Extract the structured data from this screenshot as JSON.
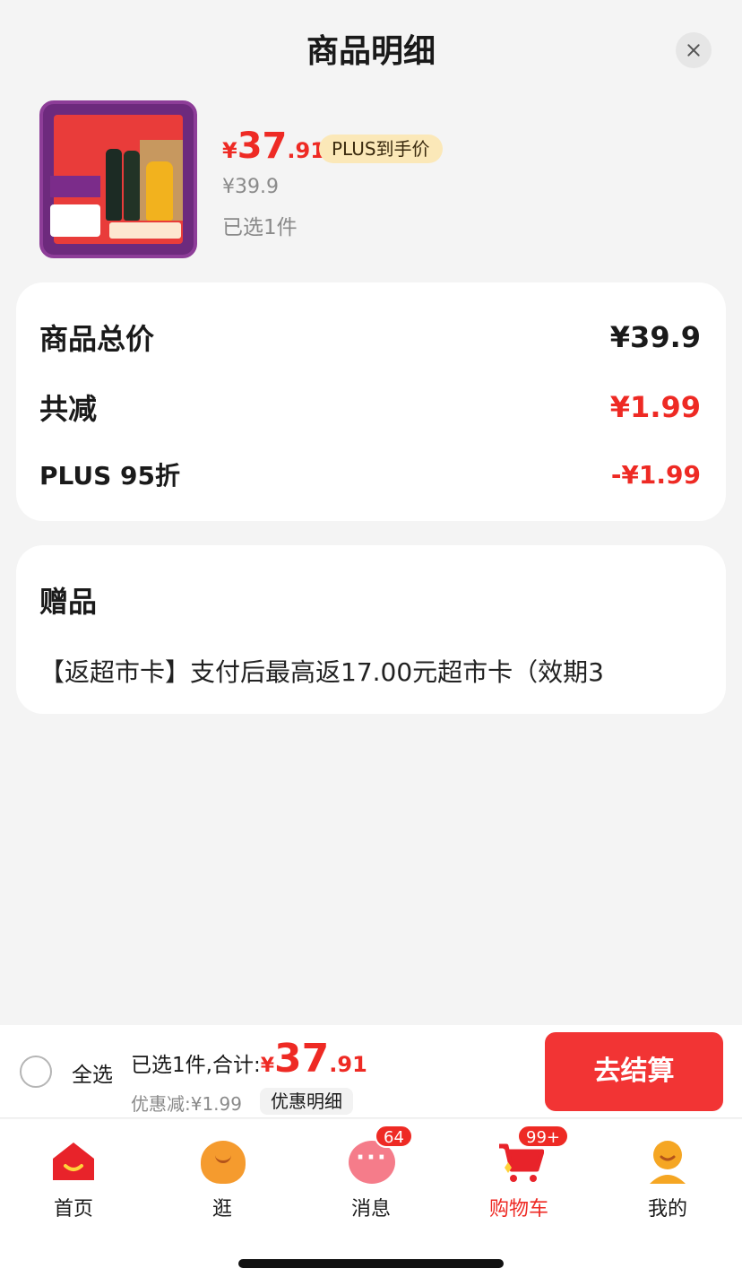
{
  "header": {
    "title": "商品明细"
  },
  "product": {
    "price_yen": "¥",
    "price_int": "37",
    "price_dec": ".91",
    "plus_badge": "PLUS到手价",
    "original_price": "¥39.9",
    "selected": "已选1件"
  },
  "summary": {
    "rows": [
      {
        "label": "商品总价",
        "value": "¥39.9"
      },
      {
        "label": "共减",
        "value": "¥1.99"
      },
      {
        "label": "PLUS 95折",
        "value": "-¥1.99"
      }
    ]
  },
  "gift": {
    "title": "赠品",
    "text": "【返超市卡】支付后最高返17.00元超市卡（效期3"
  },
  "checkout": {
    "select_all": "全选",
    "total_label": "已选1件,合计:",
    "total_yen": "¥",
    "total_int": "37",
    "total_dec": ".91",
    "discount": "优惠减:¥1.99",
    "discount_detail": "优惠明细",
    "button": "去结算"
  },
  "tabbar": {
    "items": [
      {
        "label": "首页",
        "icon": "home-icon"
      },
      {
        "label": "逛",
        "icon": "stroll-icon"
      },
      {
        "label": "消息",
        "icon": "message-icon",
        "badge": "64"
      },
      {
        "label": "购物车",
        "icon": "cart-icon",
        "badge": "99+",
        "active": true
      },
      {
        "label": "我的",
        "icon": "profile-icon"
      }
    ]
  },
  "colors": {
    "accent": "#ee2a24",
    "button": "#f23434",
    "plus_badge_bg": "#fbe8b8"
  }
}
